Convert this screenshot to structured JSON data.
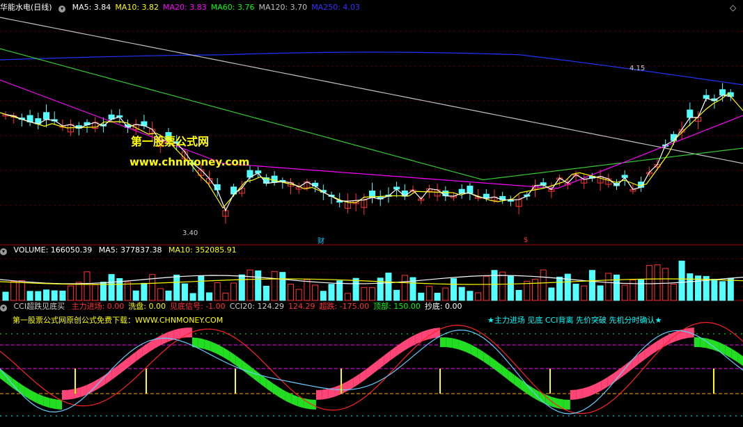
{
  "main": {
    "title": "华能水电(日线)",
    "ma_values": [
      {
        "label": "MA5:",
        "value": "3.84",
        "color": "#ffffff"
      },
      {
        "label": "MA10:",
        "value": "3.82",
        "color": "#ffff00"
      },
      {
        "label": "MA20:",
        "value": "3.83",
        "color": "#ff00ff"
      },
      {
        "label": "MA60:",
        "value": "3.76",
        "color": "#00ff00"
      },
      {
        "label": "MA120:",
        "value": "3.70",
        "color": "#c0c0c0"
      },
      {
        "label": "MA250:",
        "value": "4.03",
        "color": "#3333ff"
      }
    ],
    "high_label": "4.15",
    "low_label": "3.40",
    "marker_cai": "财",
    "marker_s": "$",
    "watermark1": "第一股票公式网",
    "watermark2": "www.chnmoney.com"
  },
  "volume": {
    "title": "VOLUME: 166050.39",
    "ma5": "MA5: 377837.38",
    "ma10": "MA10: 352085.91"
  },
  "indicator": {
    "name": "CCI超跌见底买",
    "items": [
      {
        "text": "主力进场: 0.00",
        "color": "#ff3333"
      },
      {
        "text": "洗盘: 0.00",
        "color": "#ffff00"
      },
      {
        "text": "见底信号: -1.00",
        "color": "#ff3333"
      },
      {
        "text": "CCI20: 124.29",
        "color": "#cccccc"
      },
      {
        "text": "124.29",
        "color": "#ff3333"
      },
      {
        "text": "超跌: -175.00",
        "color": "#ff3333"
      },
      {
        "text": "顶部: 150.00",
        "color": "#00ff00"
      },
      {
        "text": "抄底: 0.00",
        "color": "#ffffff"
      }
    ],
    "ad_text": "第一股票公式网原创公式免费下载：WWW.CHNMONEY.COM",
    "legend_text": "★主力进场 见底 CCI背离 先价突破 先机分时确认★"
  },
  "chart_data": {
    "type": "candlestick",
    "title": "华能水电(日线)",
    "price_range": [
      3.4,
      4.15
    ],
    "ma_latest": {
      "MA5": 3.84,
      "MA10": 3.82,
      "MA20": 3.83,
      "MA60": 3.76,
      "MA120": 3.7,
      "MA250": 4.03
    },
    "volume_latest": 166050.39,
    "volume_ma": {
      "MA5": 377837.38,
      "MA10": 352085.91
    },
    "cci20": 124.29,
    "cci_levels": {
      "oversold": -175.0,
      "top": 150.0
    }
  }
}
